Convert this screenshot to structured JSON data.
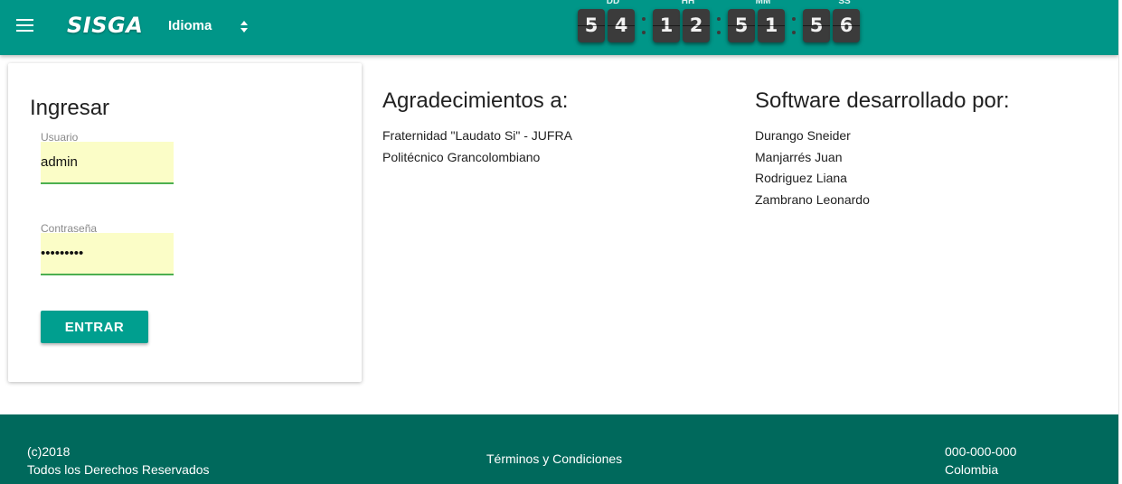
{
  "header": {
    "brand": "SISGA",
    "language_label": "Idioma",
    "countdown": {
      "labels": [
        "DD",
        "HH",
        "MM",
        "SS"
      ],
      "digits": [
        "5",
        "4",
        "1",
        "2",
        "5",
        "1",
        "5",
        "6"
      ]
    }
  },
  "login": {
    "title": "Ingresar",
    "username_label": "Usuario",
    "username_value": "admin",
    "password_label": "Contraseña",
    "password_value": "•••••••••",
    "submit_label": "ENTRAR"
  },
  "thanks": {
    "title": "Agradecimientos a:",
    "items": [
      "Fraternidad \"Laudato Si\" - JUFRA",
      "Politécnico Grancolombiano"
    ]
  },
  "developers": {
    "title": "Software desarrollado por:",
    "items": [
      "Durango Sneider",
      "Manjarrés Juan",
      "Rodriguez Liana",
      "Zambrano Leonardo"
    ]
  },
  "footer": {
    "copyright_year": "(c)2018",
    "rights": "Todos los Derechos Reservados",
    "terms_link": "Términos y Condiciones",
    "phone": "000-000-000",
    "country": "Colombia"
  },
  "colors": {
    "header_bg": "#009688",
    "footer_bg": "#00695c",
    "button_bg": "#009f8f",
    "field_bg": "#fbfdc7",
    "field_underline": "#4caf50"
  },
  "icons": [
    "menu-icon",
    "sort-arrows-icon"
  ]
}
